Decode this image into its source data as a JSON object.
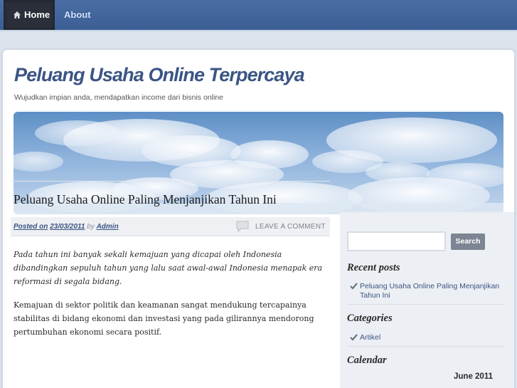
{
  "nav": {
    "items": [
      {
        "label": "Home",
        "icon": "home-icon"
      },
      {
        "label": "About"
      }
    ]
  },
  "site": {
    "title": "Peluang Usaha Online Terpercaya",
    "description": "Wujudkan impian anda, mendapatkan income dari bisnis online"
  },
  "post": {
    "title": "Peluang Usaha Online Paling Menjanjikan Tahun Ini",
    "meta": {
      "posted_on_prefix": "Posted on",
      "date": "23/03/2011",
      "by": "by",
      "author": "Admin",
      "comment_link": "LEAVE A COMMENT"
    },
    "intro": "Pada tahun ini banyak sekali kemajuan yang dicapai oleh Indonesia dibandingkan sepuluh tahun yang lalu saat awal-awal Indonesia menapak era reformasi di segala bidang.",
    "body": "Kemajuan di sektor politik dan keamanan sangat mendukung tercapainya stabilitas di bidang ekonomi dan investasi yang pada gilirannya mendorong pertumbuhan ekonomi secara positif."
  },
  "sidebar": {
    "search": {
      "placeholder": "",
      "button_label": "Search"
    },
    "recent_posts": {
      "title": "Recent posts",
      "items": [
        {
          "label": "Peluang Usaha Online Paling Menjanjikan Tahun Ini"
        }
      ]
    },
    "categories": {
      "title": "Categories",
      "items": [
        {
          "label": "Artikel"
        }
      ]
    },
    "calendar": {
      "title": "Calendar",
      "caption": "June 2011"
    }
  },
  "colors": {
    "nav_background": "#4a6ea3",
    "nav_active": "#2a2f3a",
    "title_blue": "#3b5584",
    "sidebar_background": "#eceff3",
    "search_button": "#7d8592"
  }
}
